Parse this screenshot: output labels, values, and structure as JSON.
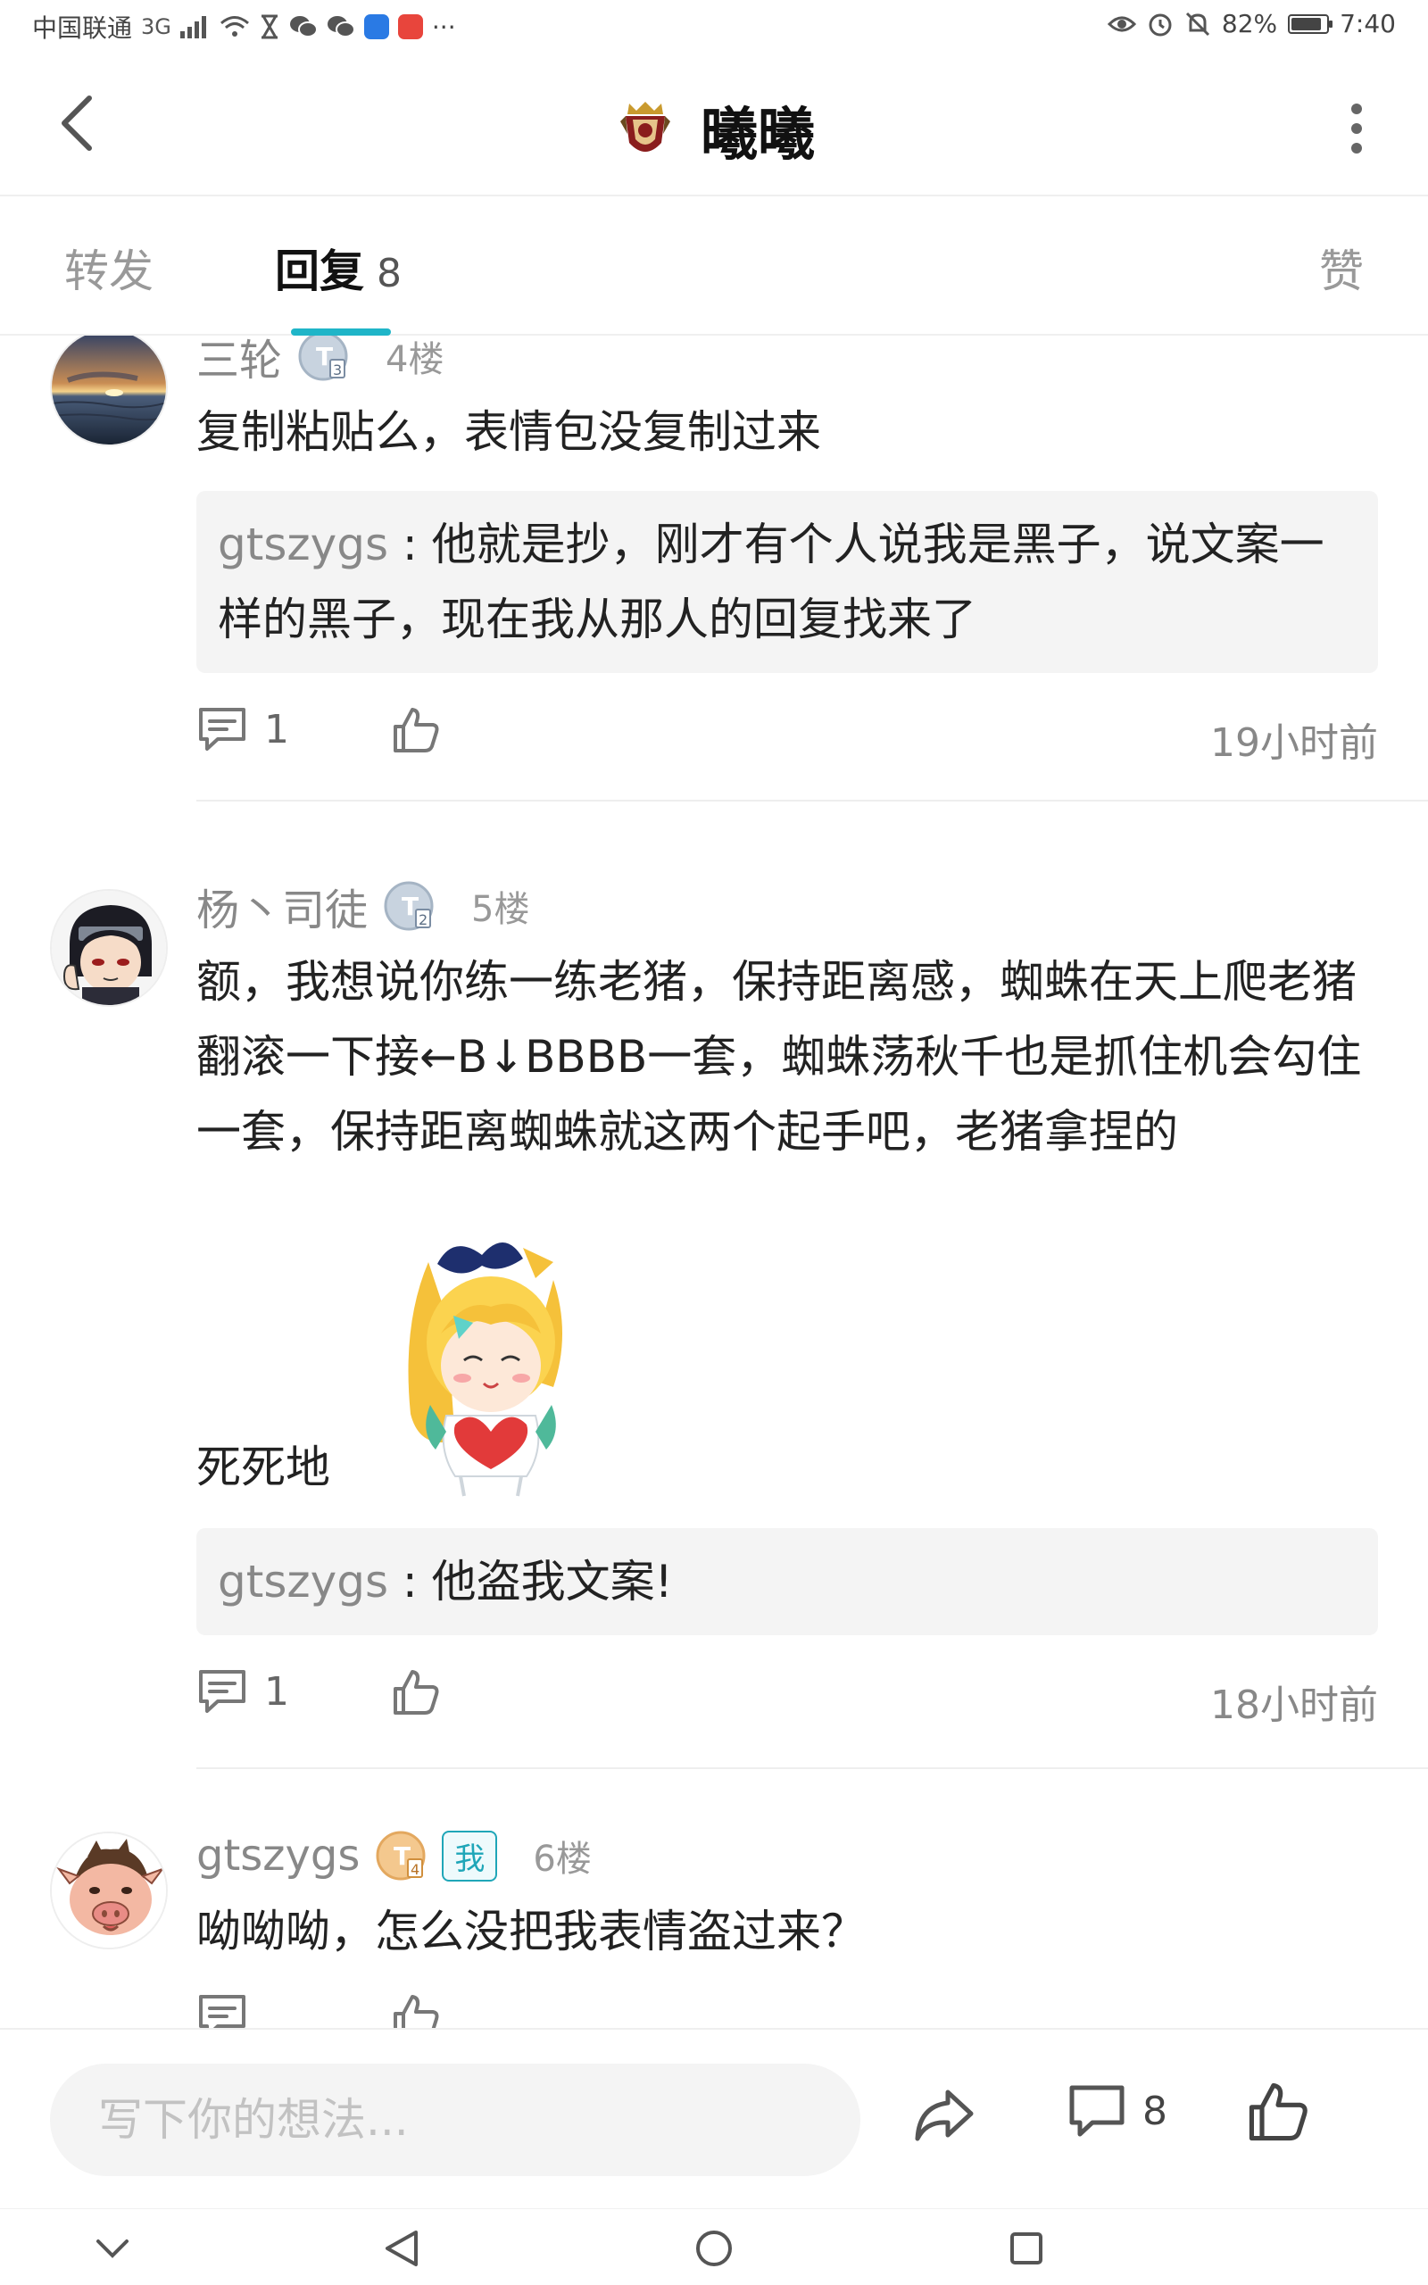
{
  "status_bar": {
    "carrier": "中国联通",
    "network": "3G",
    "battery": "82%",
    "time": "7:40"
  },
  "header": {
    "title": "曦曦"
  },
  "tabs": {
    "forward": "转发",
    "reply": "回复",
    "reply_count": "8",
    "like": "赞"
  },
  "comments": [
    {
      "name": "三轮",
      "level": "3",
      "floor": "4楼",
      "text": "复制粘贴么，表情包没复制过来",
      "quote_name": "gtszygs",
      "quote_sep": " : ",
      "quote_text": "他就是抄，刚才有个人说我是黑子，说文案一样的黑子，现在我从那人的回复找来了",
      "reply_count": "1",
      "time": "19小时前"
    },
    {
      "name": "杨丶司徒",
      "level": "2",
      "floor": "5楼",
      "text": "额，我想说你练一练老猪，保持距离感，蜘蛛在天上爬老猪翻滚一下接←B↓BBBB一套，蜘蛛荡秋千也是抓住机会勾住一套，保持距离蜘蛛就这两个起手吧，老猪拿捏的",
      "sticker_text": "死死地",
      "quote_name": "gtszygs",
      "quote_sep": " : ",
      "quote_text": "他盗我文案!",
      "reply_count": "1",
      "time": "18小时前"
    },
    {
      "name": "gtszygs",
      "level": "4",
      "me": "我",
      "floor": "6楼",
      "text": "呦呦呦，怎么没把我表情盗过来？"
    }
  ],
  "input_bar": {
    "placeholder": "写下你的想法...",
    "comment_count": "8"
  },
  "colors": {
    "accent": "#1fb5c8",
    "text_primary": "#222222",
    "text_secondary": "#888888",
    "quote_bg": "#f4f4f4"
  }
}
